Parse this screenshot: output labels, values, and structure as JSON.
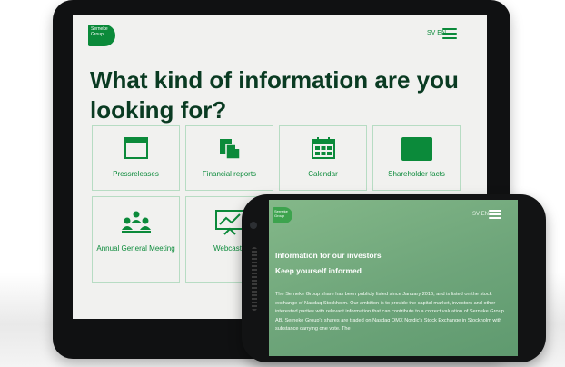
{
  "tablet": {
    "logo_text": "Serneke Group",
    "lang_label": "SV EN",
    "heading": "What kind of information are you looking for?",
    "tiles": [
      {
        "label": "Pressreleases",
        "icon": "browser-window-icon"
      },
      {
        "label": "Financial reports",
        "icon": "documents-icon"
      },
      {
        "label": "Calendar",
        "icon": "calendar-icon"
      },
      {
        "label": "Shareholder facts",
        "icon": "folder-icon"
      },
      {
        "label": "Annual General Meeting",
        "icon": "people-meeting-icon"
      },
      {
        "label": "Webcasts",
        "icon": "presentation-chart-icon"
      }
    ]
  },
  "phone": {
    "logo_text": "Serneke Group",
    "lang_label": "SV EN",
    "title": "Information for our investors",
    "subtitle": "Keep yourself informed",
    "body": "The Serneke Group share has been publicly listed since January 2016, and is listed on the stock exchange of Nasdaq Stockholm. Our ambition is to provide the capital market, investors and other interested parties with relevant information that can contribute to a correct valuation of Serneke Group AB. Serneke Group's shares are traded on Nasdaq OMX Nordic's Stock Exchange in Stockholm with substance carrying one vote. The"
  },
  "colors": {
    "brand_green": "#0b8a3a",
    "heading_dark": "#0a3b22",
    "tablet_bg": "#f1f1ef",
    "phone_bg": "#6ea57a"
  }
}
